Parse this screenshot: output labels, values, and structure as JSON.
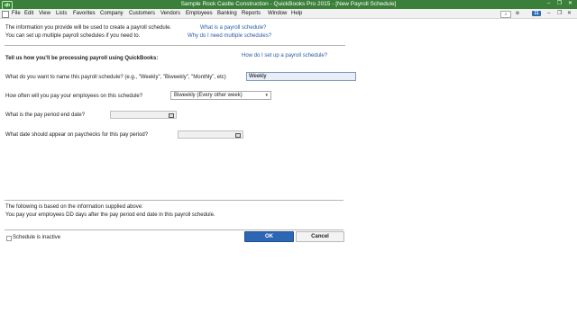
{
  "window": {
    "logo": "qb",
    "title": "Sample Rock Castle Construction  - QuickBooks Pro 2015 - [New Payroll Schedule]",
    "controls": [
      "minimize",
      "restore",
      "close"
    ]
  },
  "menubar": {
    "items": [
      "File",
      "Edit",
      "View",
      "Lists",
      "Favorites",
      "Company",
      "Customers",
      "Vendors",
      "Employees",
      "Banking",
      "Reports",
      "Window",
      "Help"
    ],
    "badge_count": "11"
  },
  "intro": {
    "line1": "The information you provide will be used to create a payroll schedule.",
    "line2": "You can set up multiple payroll schedules if you need to.",
    "link1": "What is a payroll schedule?",
    "link2": "Why do I need multiple schedules?"
  },
  "section": {
    "heading": "Tell us how you'll be processing payroll using QuickBooks:",
    "help_link": "How do I set up a payroll schedule?"
  },
  "form": {
    "name_label": "What do you want to name this payroll schedule? (e.g., \"Weekly\", \"Biweekly\", \"Monthly\", etc)",
    "name_value": "Weekly",
    "frequency_label": "How often will you pay your employees on this schedule?",
    "frequency_value": "Biweekly (Every other week)",
    "period_end_label": "What is the pay period end date?",
    "paycheck_date_label": "What date should appear on paychecks for this pay period?"
  },
  "summary": {
    "line1": "The following is based on the information supplied above:",
    "line2": "You pay your employees DD days after the pay period end date in this payroll schedule."
  },
  "footer": {
    "inactive_label": "Schedule is inactive",
    "ok_label": "OK",
    "cancel_label": "Cancel"
  },
  "colors": {
    "titlebar": "#3a7f3a",
    "link": "#2a5ba8",
    "ok_button": "#2d67b4"
  }
}
